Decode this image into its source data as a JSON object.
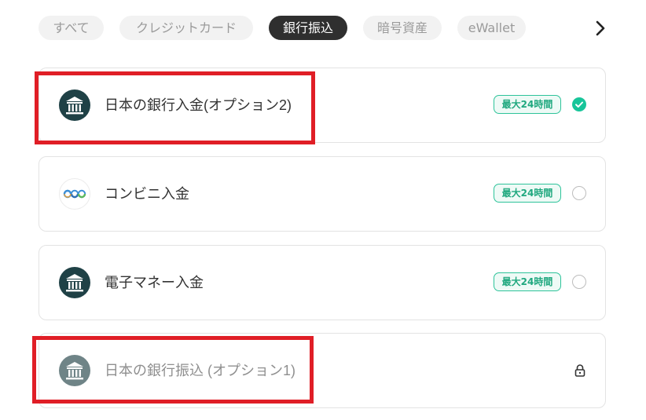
{
  "tabs": {
    "items": [
      {
        "label": "すべて"
      },
      {
        "label": "クレジットカード"
      },
      {
        "label": "銀行振込"
      },
      {
        "label": "暗号資産"
      },
      {
        "label": "eWallet"
      }
    ],
    "active_index": 2,
    "next_icon": "chevron-right-icon"
  },
  "methods": [
    {
      "title": "日本の銀行入金(オプション2)",
      "icon": "bank-icon",
      "badge": "最大24時間",
      "selected": true,
      "locked": false
    },
    {
      "title": "コンビニ入金",
      "icon": "convenience-store-icon",
      "badge": "最大24時間",
      "selected": false,
      "locked": false
    },
    {
      "title": "電子マネー入金",
      "icon": "bank-icon",
      "badge": "最大24時間",
      "selected": false,
      "locked": false
    },
    {
      "title": "日本の銀行振込 (オプション1)",
      "icon": "bank-icon",
      "badge": "",
      "selected": false,
      "locked": true
    }
  ],
  "colors": {
    "highlight": "#e01e26",
    "accent": "#18c59a",
    "icon_bg": "#1f4146"
  }
}
